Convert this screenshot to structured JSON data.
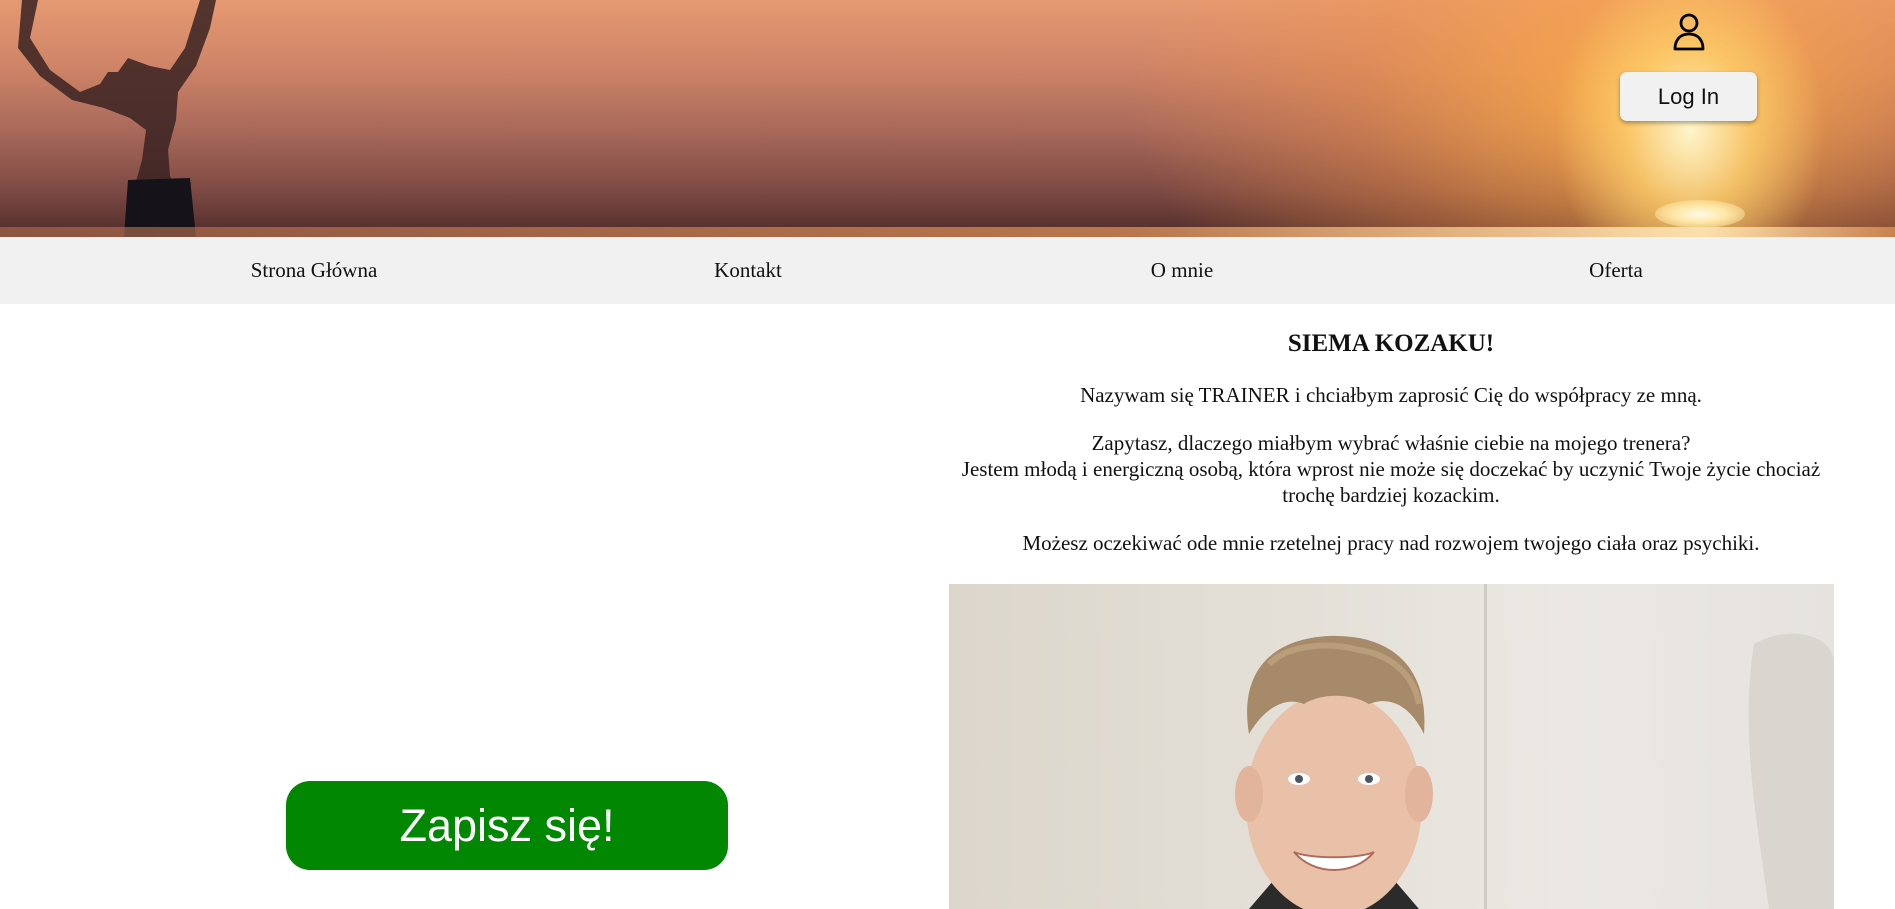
{
  "header": {
    "login_label": "Log In",
    "user_icon": "user-icon"
  },
  "nav": {
    "items": [
      {
        "label": "Strona Główna"
      },
      {
        "label": "Kontakt"
      },
      {
        "label": "O mnie"
      },
      {
        "label": "Oferta"
      }
    ]
  },
  "signup": {
    "label": "Zapisz się!",
    "color": "#018701"
  },
  "intro": {
    "heading": "SIEMA KOZAKU!",
    "paragraph1": "Nazywam się TRAINER i chciałbym zaprosić Cię do współpracy ze mną.",
    "paragraph2_line1": "Zapytasz, dlaczego miałbym wybrać właśnie ciebie na mojego trenera?",
    "paragraph2_line2": "Jestem młodą i energiczną osobą, która wprost nie może się doczekać by uczynić Twoje życie chociaż trochę bardziej kozackim.",
    "paragraph3": "Możesz oczekiwać ode mnie rzetelnej pracy nad rozwojem twojego ciała oraz psychiki."
  }
}
